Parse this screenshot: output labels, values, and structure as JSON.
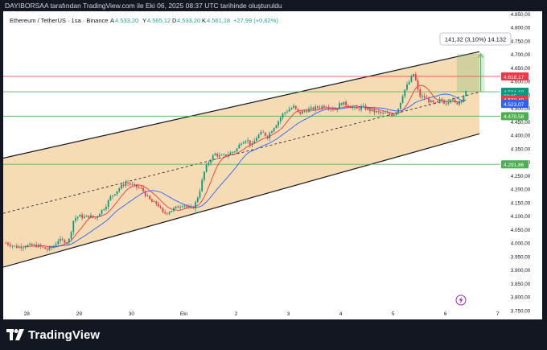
{
  "header": {
    "caption": "DAYIBORSAA tarafından TradingView.com ile Eki 06, 2025 08:37 UTC tarihinde oluşturuldu"
  },
  "legend": {
    "symbol": "Ethereum / TetherUS · 1sa · Binance",
    "open_label": "A",
    "open_value": "4.533,20",
    "high_label": "Y",
    "high_value": "4.565,12",
    "low_label": "D",
    "low_value": "4.533,20",
    "close_label": "K",
    "close_value": "4.561,18",
    "change": "+27,99 (+0,62%)",
    "open_color": "#26a69a",
    "close_color": "#26a69a"
  },
  "measure": {
    "label": "141,32 (3,10%) 14.132"
  },
  "price_tags": [
    {
      "text": "4.618,17",
      "price": 4618.17,
      "bg": "#f23645"
    },
    {
      "text": "4.561,18",
      "price": 4561.18,
      "bg": "#089981"
    },
    {
      "text": "22:35",
      "price": 4546,
      "bg": "#089981"
    },
    {
      "text": "4.532,40",
      "price": 4532.4,
      "bg": "#f23645"
    },
    {
      "text": "4.523,07",
      "price": 4516,
      "bg": "#2962ff"
    },
    {
      "text": "4.470,58",
      "price": 4470.58,
      "bg": "#4caf50"
    },
    {
      "text": "4.291,86",
      "price": 4291.86,
      "bg": "#4caf50"
    }
  ],
  "brand": {
    "name": "TradingView"
  },
  "chart_data": {
    "type": "candlestick",
    "symbol": "ETHUSDT",
    "timeframe": "1h",
    "x_ticks": [
      "28",
      "29",
      "30",
      "Eki",
      "2",
      "3",
      "4",
      "5",
      "6",
      "7"
    ],
    "y_ticks": [
      "4.850,00",
      "4.800,00",
      "4.750,00",
      "4.700,00",
      "4.650,00",
      "4.600,00",
      "4.550,00",
      "4.500,00",
      "4.450,00",
      "4.400,00",
      "4.350,00",
      "4.300,00",
      "4.250,00",
      "4.200,00",
      "4.150,00",
      "4.100,00",
      "4.050,00",
      "4.000,00",
      "3.950,00",
      "3.900,00",
      "3.850,00",
      "3.800,00",
      "3.750,00"
    ],
    "ylim": [
      3740,
      4860
    ],
    "close_path": [
      [
        27.6,
        4000
      ],
      [
        27.8,
        3985
      ],
      [
        28.0,
        3990
      ],
      [
        28.2,
        3990
      ],
      [
        28.4,
        3975
      ],
      [
        28.5,
        3985
      ],
      [
        28.6,
        4010
      ],
      [
        28.8,
        4005
      ],
      [
        28.9,
        4090
      ],
      [
        29.0,
        4100
      ],
      [
        29.1,
        4095
      ],
      [
        29.2,
        4100
      ],
      [
        29.3,
        4090
      ],
      [
        29.4,
        4115
      ],
      [
        29.5,
        4135
      ],
      [
        29.6,
        4170
      ],
      [
        29.7,
        4190
      ],
      [
        29.8,
        4210
      ],
      [
        29.9,
        4225
      ],
      [
        30.0,
        4215
      ],
      [
        30.2,
        4200
      ],
      [
        30.3,
        4170
      ],
      [
        30.4,
        4150
      ],
      [
        30.5,
        4145
      ],
      [
        30.6,
        4110
      ],
      [
        30.7,
        4115
      ],
      [
        30.8,
        4125
      ],
      [
        30.9,
        4135
      ],
      [
        31.0,
        4145
      ],
      [
        31.1,
        4125
      ],
      [
        31.2,
        4135
      ],
      [
        31.3,
        4190
      ],
      [
        31.4,
        4270
      ],
      [
        31.5,
        4310
      ],
      [
        31.6,
        4330
      ],
      [
        31.7,
        4320
      ],
      [
        31.8,
        4325
      ],
      [
        32.0,
        4345
      ],
      [
        32.1,
        4375
      ],
      [
        32.2,
        4385
      ],
      [
        32.3,
        4360
      ],
      [
        32.4,
        4395
      ],
      [
        32.5,
        4410
      ],
      [
        32.6,
        4395
      ],
      [
        32.7,
        4425
      ],
      [
        32.8,
        4450
      ],
      [
        32.9,
        4480
      ],
      [
        33.0,
        4495
      ],
      [
        33.1,
        4505
      ],
      [
        33.2,
        4480
      ],
      [
        33.3,
        4490
      ],
      [
        33.5,
        4500
      ],
      [
        33.7,
        4510
      ],
      [
        33.9,
        4495
      ],
      [
        34.0,
        4520
      ],
      [
        34.1,
        4515
      ],
      [
        34.2,
        4505
      ],
      [
        34.3,
        4495
      ],
      [
        34.4,
        4505
      ],
      [
        34.6,
        4490
      ],
      [
        34.8,
        4480
      ],
      [
        35.0,
        4475
      ],
      [
        35.1,
        4500
      ],
      [
        35.2,
        4560
      ],
      [
        35.3,
        4595
      ],
      [
        35.4,
        4630
      ],
      [
        35.5,
        4545
      ],
      [
        35.6,
        4540
      ],
      [
        35.7,
        4525
      ],
      [
        35.8,
        4515
      ],
      [
        35.9,
        4530
      ],
      [
        36.0,
        4520
      ],
      [
        36.1,
        4535
      ],
      [
        36.2,
        4515
      ],
      [
        36.3,
        4533
      ],
      [
        36.4,
        4561
      ]
    ],
    "overlays": [
      {
        "name": "channel upper",
        "from": [
          27.55,
          4315
        ],
        "to": [
          36.65,
          4710
        ],
        "color": "#000000"
      },
      {
        "name": "channel lower",
        "from": [
          27.55,
          3910
        ],
        "to": [
          36.65,
          4405
        ],
        "color": "#000000"
      },
      {
        "name": "channel median",
        "from": [
          27.55,
          4110
        ],
        "to": [
          36.65,
          4560
        ],
        "style": "dashed"
      }
    ],
    "hlines": [
      {
        "price": 4618.17,
        "color": "#f23645"
      },
      {
        "price": 4561.18,
        "color": "#4caf50"
      },
      {
        "price": 4470.58,
        "color": "#4caf50"
      },
      {
        "price": 4291.86,
        "color": "#4caf50"
      }
    ],
    "measurement": {
      "from_price": 4561.18,
      "to_price": 4702.5,
      "change": "141,32 (3,10%)",
      "ticks": "14.132",
      "x_start": 36.6,
      "x_end": 36.75
    },
    "fill_color": "#f5d6a8",
    "up_color": "#089981",
    "down_color": "#f23645",
    "ma_colors": [
      "#f23645",
      "#2962ff"
    ]
  }
}
